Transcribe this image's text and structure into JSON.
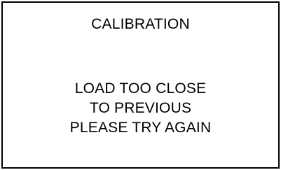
{
  "screen": {
    "title": "CALIBRATION",
    "message_lines": [
      "LOAD TOO CLOSE",
      "TO PREVIOUS",
      "PLEASE TRY AGAIN"
    ]
  }
}
